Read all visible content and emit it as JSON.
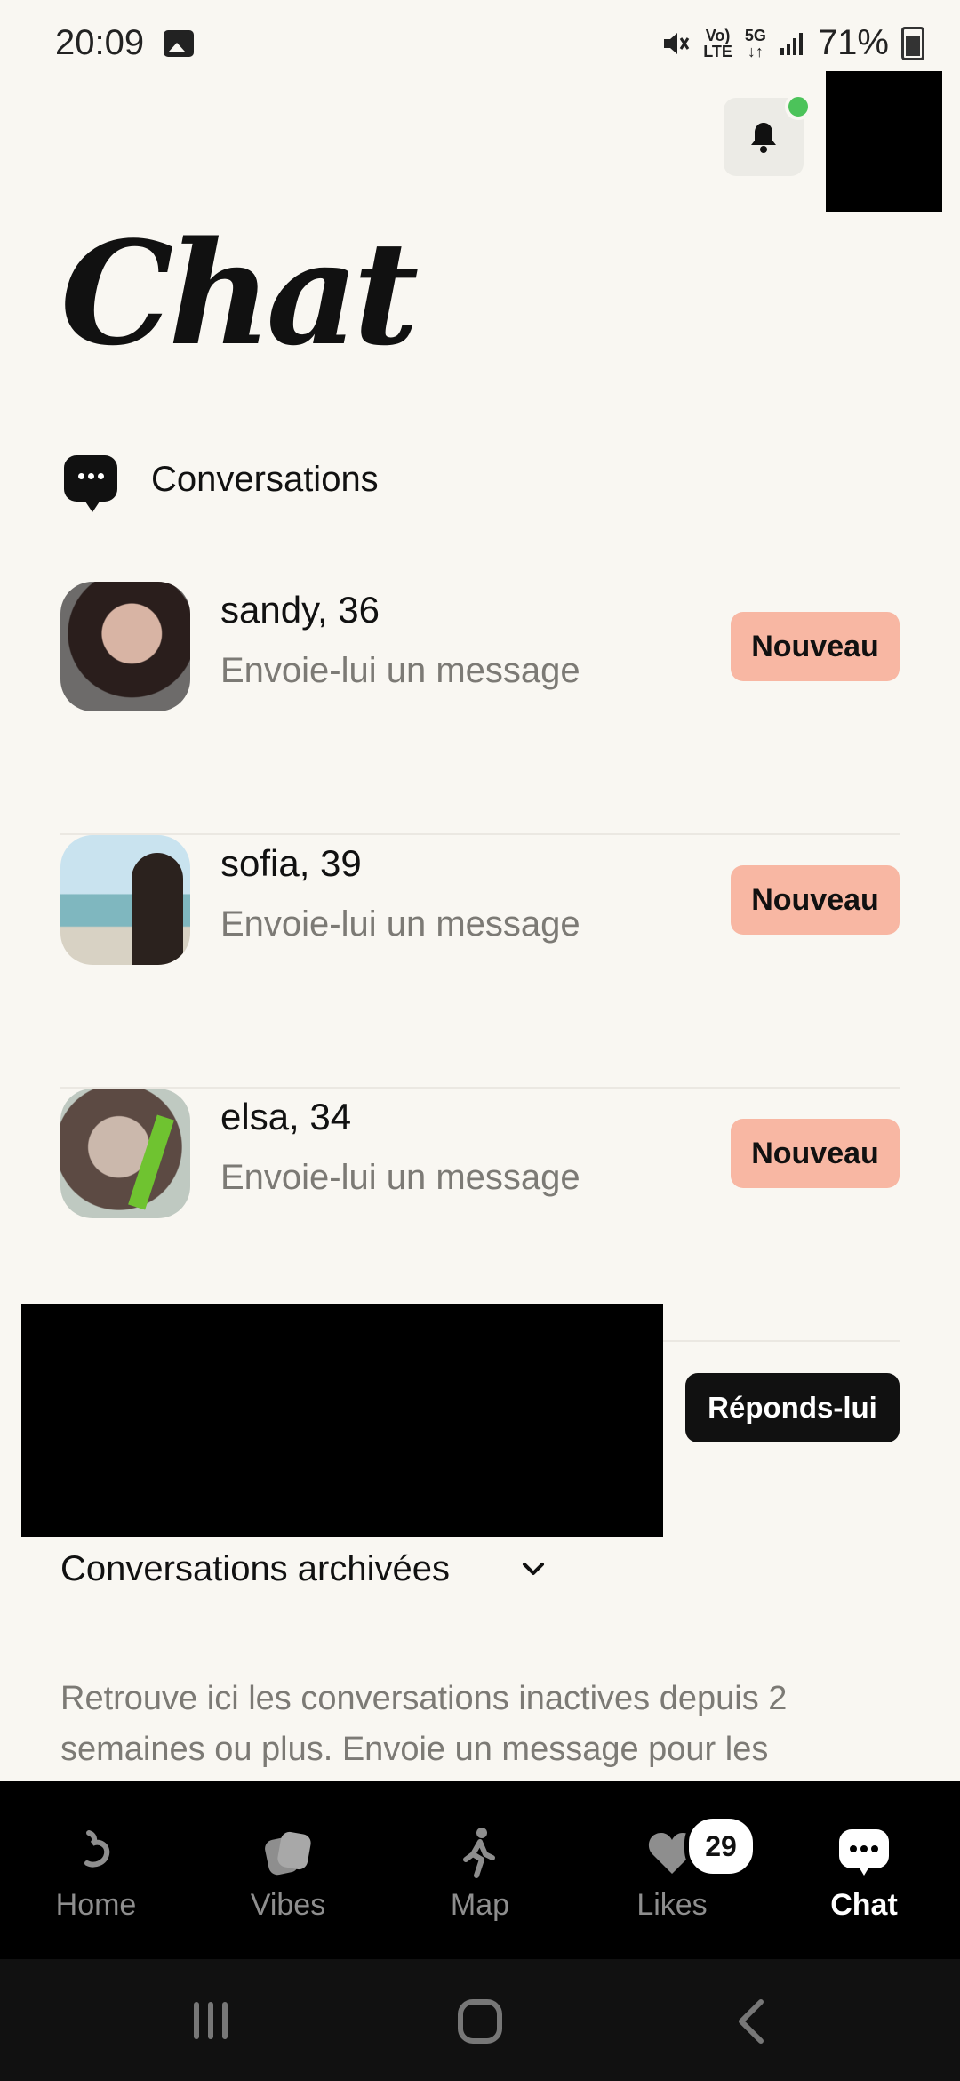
{
  "status_bar": {
    "time": "20:09",
    "volte_top": "Vo)",
    "volte_bottom": "LTE",
    "network": "5G",
    "battery": "71%"
  },
  "header": {
    "title": "Chat"
  },
  "section": {
    "title": "Conversations"
  },
  "conversations": [
    {
      "name": "sandy, 36",
      "subtitle": "Envoie-lui un message",
      "badge": "Nouveau"
    },
    {
      "name": "sofia, 39",
      "subtitle": "Envoie-lui un message",
      "badge": "Nouveau"
    },
    {
      "name": "elsa, 34",
      "subtitle": "Envoie-lui un message",
      "badge": "Nouveau"
    }
  ],
  "reply_button": "Réponds-lui",
  "archived": {
    "title": "Conversations archivées",
    "description": "Retrouve ici les conversations inactives depuis 2 semaines ou plus. Envoie un message pour les"
  },
  "bottom_nav": [
    {
      "label": "Home",
      "icon": "home-swirl-icon"
    },
    {
      "label": "Vibes",
      "icon": "vibes-cards-icon"
    },
    {
      "label": "Map",
      "icon": "walking-person-icon"
    },
    {
      "label": "Likes",
      "icon": "heart-icon",
      "badge": "29"
    },
    {
      "label": "Chat",
      "icon": "chat-bubble-icon",
      "active": true
    }
  ],
  "colors": {
    "background": "#f9f7f2",
    "badge": "#f8b7a3",
    "online_dot": "#4cc35a",
    "nav_bg": "#000000"
  }
}
